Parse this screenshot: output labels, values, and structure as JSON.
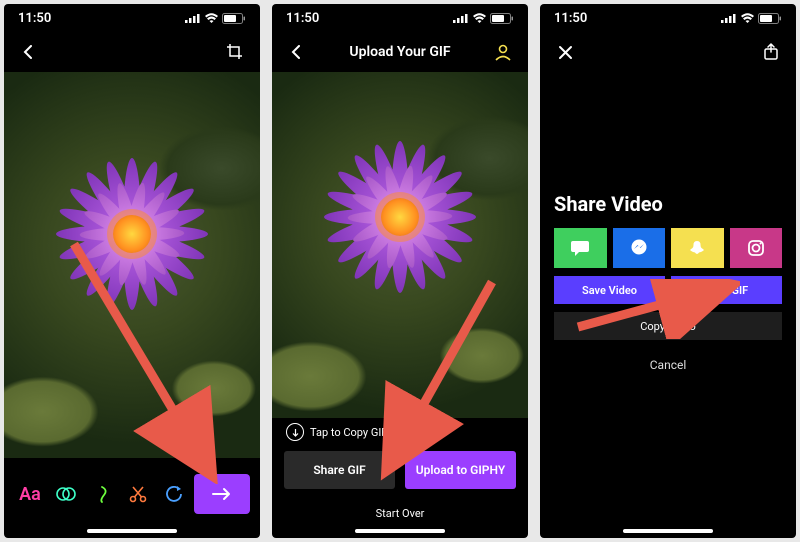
{
  "status": {
    "time": "11:50"
  },
  "screen1": {
    "tools": {
      "text": "Aa"
    }
  },
  "screen2": {
    "title": "Upload Your GIF",
    "tap_copy": "Tap to Copy GIF",
    "share_gif": "Share GIF",
    "upload_giphy": "Upload to GIPHY",
    "start_over": "Start Over"
  },
  "screen3": {
    "title": "Share Video",
    "save_video": "Save Video",
    "save_gif": "Save GIF",
    "copy_video": "Copy Video",
    "cancel": "Cancel"
  }
}
